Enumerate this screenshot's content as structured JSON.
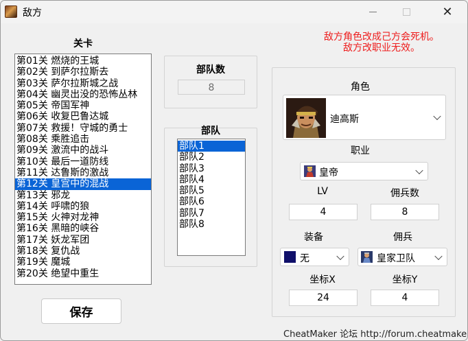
{
  "window": {
    "title": "敌方",
    "colors": {
      "selection": "#0a64d6",
      "warning": "#ee1c1c"
    }
  },
  "levels": {
    "heading": "关卡",
    "selected_index": 11,
    "items": [
      "第01关 燃烧的王城",
      "第02关 到萨尔拉斯去",
      "第03关 萨尔拉斯城之战",
      "第04关 幽灵出没的恐怖丛林",
      "第05关 帝国军神",
      "第06关 收复巴鲁达城",
      "第07关 救援！守城的勇士",
      "第08关 乘胜追击",
      "第09关 激流中的战斗",
      "第10关 最后一道防线",
      "第11关 达鲁斯的激战",
      "第12关 皇宫中的混战",
      "第13关 邪龙",
      "第14关 呼啸的狼",
      "第15关 火神对龙神",
      "第16关 黑暗的峡谷",
      "第17关 妖龙军团",
      "第18关 复仇战",
      "第19关 魔城",
      "第20关 绝望中重生"
    ]
  },
  "save_label": "保存",
  "troop_count": {
    "heading": "部队数",
    "value": "8"
  },
  "troops": {
    "heading": "部队",
    "selected_index": 0,
    "items": [
      "部队1",
      "部队2",
      "部队3",
      "部队4",
      "部队5",
      "部队6",
      "部队7",
      "部队8"
    ]
  },
  "warning": {
    "line1": "敌方角色改成己方会死机。",
    "line2": "敌方改职业无效。"
  },
  "unit": {
    "role_label": "角色",
    "role_value": "迪高斯",
    "class_label": "职业",
    "class_value": "皇帝",
    "lv_label": "LV",
    "lv_value": "4",
    "mercs_label": "佣兵数",
    "mercs_value": "8",
    "equip_label": "装备",
    "equip_value": "无",
    "merc_label": "佣兵",
    "merc_value": "皇家卫队",
    "x_label": "坐标X",
    "x_value": "24",
    "y_label": "坐标Y",
    "y_value": "4"
  },
  "footer": "CheatMaker 论坛 http://forum.cheatmaker.org/"
}
